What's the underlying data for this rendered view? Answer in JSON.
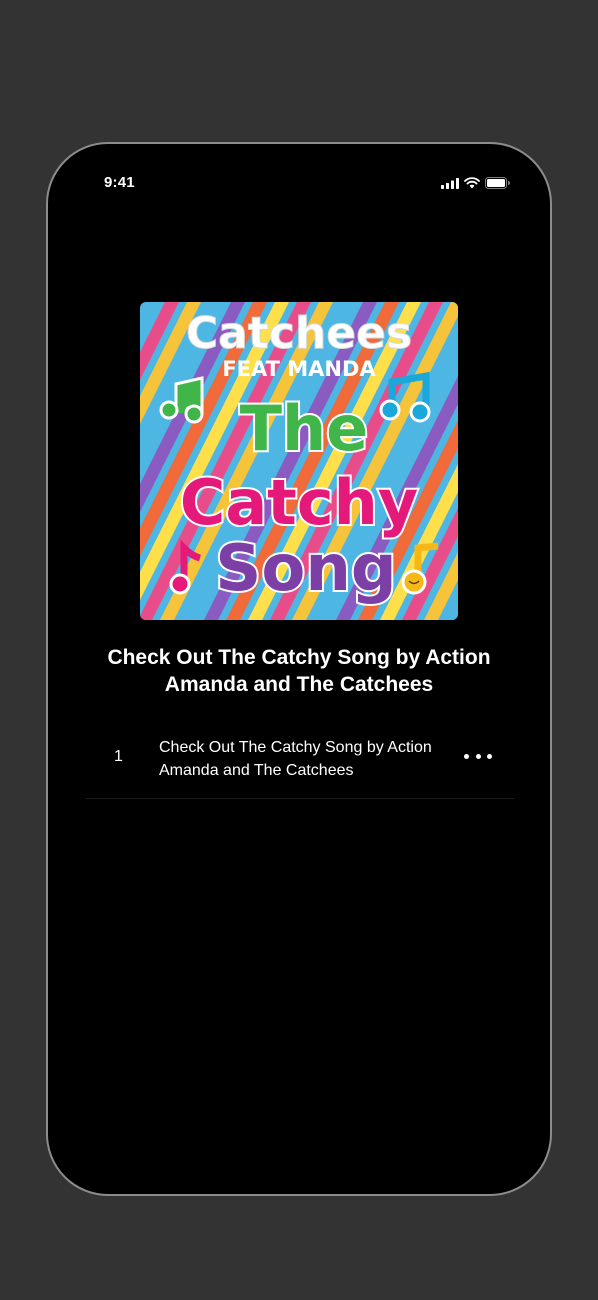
{
  "status_bar": {
    "time": "9:41",
    "icons": [
      "cellular-signal-icon",
      "wifi-icon",
      "battery-icon"
    ]
  },
  "album": {
    "cover_art": {
      "artist_text": "Catchees",
      "feat_text": "FEAT MANDA",
      "title_lines": [
        "The",
        "Catchy",
        "Song"
      ]
    },
    "title": "Check Out The Catchy Song by Action Amanda and The Catchees"
  },
  "tracks": [
    {
      "number": "1",
      "title": "Check Out The Catchy Song by Action Amanda and The Catchees",
      "more_icon": "more-options-icon"
    }
  ],
  "colors": {
    "background": "#333333",
    "screen": "#000000",
    "text": "#ffffff",
    "cover_stripes": [
      "#e84d8a",
      "#f5c43b",
      "#4db6e3",
      "#8a5cc2",
      "#f06a3a",
      "#ffe04a"
    ],
    "cover_title_green": "#3fb54a",
    "cover_title_blue": "#1aa7d9",
    "cover_title_pink": "#e5197a",
    "cover_title_yellow": "#f5b818",
    "cover_title_purple": "#7b3fa6"
  }
}
